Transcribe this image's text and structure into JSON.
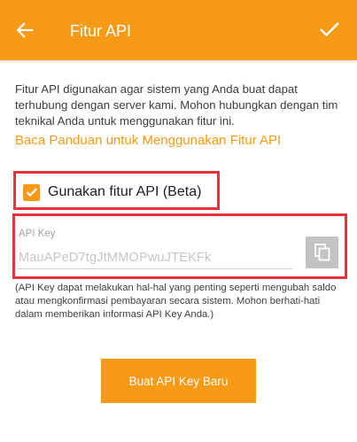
{
  "appbar": {
    "title": "Fitur API",
    "back_icon": "arrow-left-icon",
    "done_icon": "checkmark-icon"
  },
  "description": "Fitur API digunakan agar sistem yang Anda buat dapat terhubung dengan server kami. Mohon hubungkan dengan tim teknikal Anda untuk menggunakan fitur ini.",
  "guide_link": "Baca Panduan untuk Menggunakan Fitur API",
  "api_toggle": {
    "label": "Gunakan fitur API (Beta)",
    "checked": true
  },
  "api_key": {
    "label": "API Key",
    "value": "MauAPeD7tgJtMMOPwuJTEKFk",
    "copy_icon": "copy-icon"
  },
  "warning_note": "(API Key dapat melakukan hal-hal yang penting seperti mengubah saldo atau mengkonfirmasi pembayaran secara sistem. Mohon berhati-hati dalam memberikan informasi API Key Anda.)",
  "generate_button": "Buat API Key Baru",
  "colors": {
    "accent": "#f79a16",
    "highlight": "#e5323b",
    "disabled": "#c3c3c3"
  }
}
